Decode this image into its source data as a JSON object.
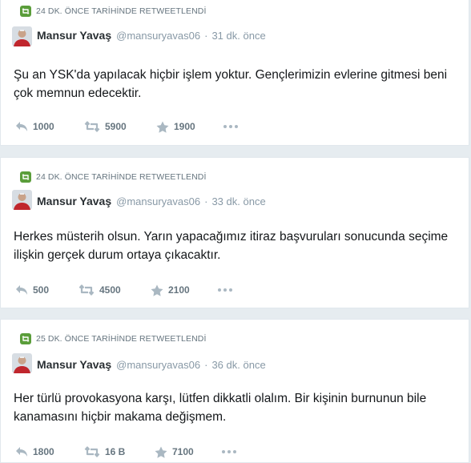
{
  "colors": {
    "background": "#e6ecf0",
    "card": "#ffffff",
    "retweet_badge": "#5a9d3a",
    "muted": "#8899a6",
    "action_icon": "#aab8c2"
  },
  "tweets": [
    {
      "retweet_label": "24 DK. ÖNCE TARİHİNDE RETWEETLENDİ",
      "name": "Mansur Yavaş",
      "handle": "@mansuryavas06",
      "separator": "·",
      "time": "31 dk. önce",
      "text": "Şu an YSK'da yapılacak hiçbir işlem yoktur. Gençlerimizin evlerine gitmesi beni çok memnun edecektir.",
      "replies": "1000",
      "retweets": "5900",
      "likes": "1900"
    },
    {
      "retweet_label": "24 DK. ÖNCE TARİHİNDE RETWEETLENDİ",
      "name": "Mansur Yavaş",
      "handle": "@mansuryavas06",
      "separator": "·",
      "time": "33 dk. önce",
      "text": "Herkes müsterih olsun. Yarın yapacağımız itiraz başvuruları sonucunda seçime ilişkin gerçek durum ortaya çıkacaktır.",
      "replies": "500",
      "retweets": "4500",
      "likes": "2100"
    },
    {
      "retweet_label": "25 DK. ÖNCE TARİHİNDE RETWEETLENDİ",
      "name": "Mansur Yavaş",
      "handle": "@mansuryavas06",
      "separator": "·",
      "time": "36 dk. önce",
      "text": "Her türlü provokasyona karşı, lütfen dikkatli olalım. Bir kişinin burnunun bile kanamasını hiçbir makama değişmem.",
      "replies": "1800",
      "retweets": "16 B",
      "likes": "7100"
    }
  ]
}
